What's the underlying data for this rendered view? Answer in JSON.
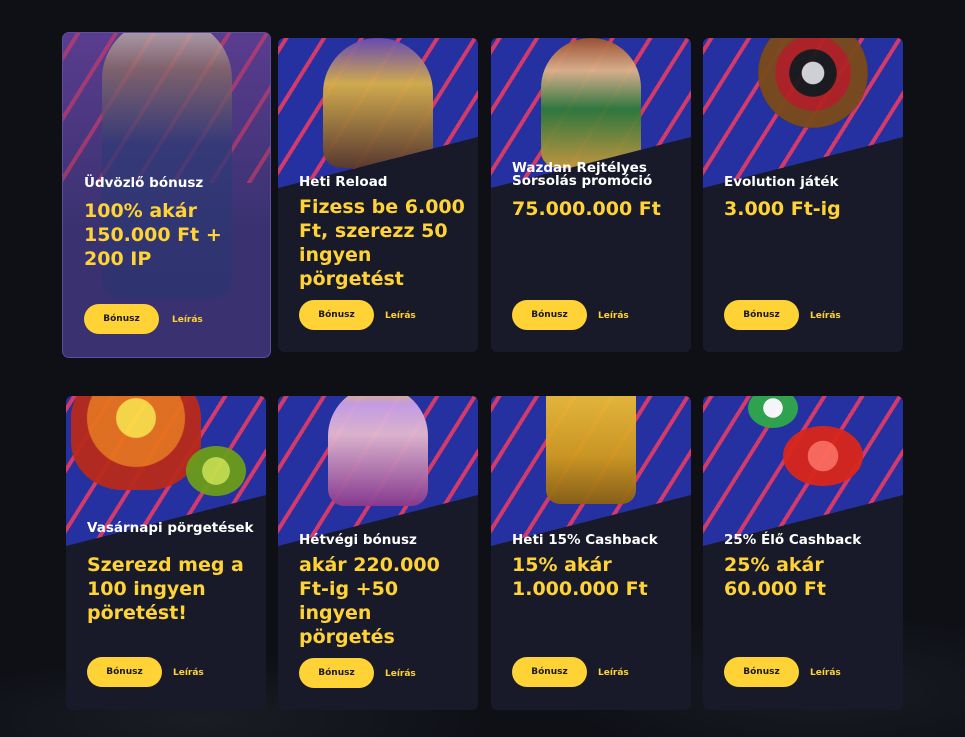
{
  "cards": [
    {
      "title": "Üdvözlő bónusz",
      "promo": "100% akár 150.000 Ft + 200 IP",
      "button": "Bónusz",
      "link": "Leírás"
    },
    {
      "title": "Heti Reload",
      "promo": "Fizess be 6.000 Ft, szerezz 50 ingyen pörgetést",
      "button": "Bónusz",
      "link": "Leírás"
    },
    {
      "title": "Wazdan Rejtélyes Sorsolás promóció",
      "promo": "75.000.000 Ft",
      "button": "Bónusz",
      "link": "Leírás"
    },
    {
      "title": "Evolution játék",
      "promo": "3.000 Ft-ig",
      "button": "Bónusz",
      "link": "Leírás"
    },
    {
      "title": "Vasárnapi pörgetések",
      "promo": "Szerezd meg a 100 ingyen pöretést!",
      "button": "Bónusz",
      "link": "Leírás"
    },
    {
      "title": "Hétvégi bónusz",
      "promo": "akár 220.000 Ft-ig +50 ingyen pörgetés",
      "button": "Bónusz",
      "link": "Leírás"
    },
    {
      "title": "Heti 15% Cashback",
      "promo": "15% akár 1.000.000 Ft",
      "button": "Bónusz",
      "link": "Leírás"
    },
    {
      "title": "25%  Élő Cashback",
      "promo": "25% akár 60.000 Ft",
      "button": "Bónusz",
      "link": "Leírás"
    }
  ],
  "colors": {
    "accent_yellow": "#ffd235",
    "card_bg": "#181a29",
    "active_card_bg": "#3a3270",
    "banner_blue": "#2531a0",
    "stripe_red": "#e63b63",
    "page_bg": "#0e1016"
  },
  "icons": [
    "princess-character",
    "pirate-character",
    "warrior-woman-character",
    "roulette-wheel",
    "bear-character",
    "queen-character",
    "robot-character",
    "casino-chips"
  ]
}
